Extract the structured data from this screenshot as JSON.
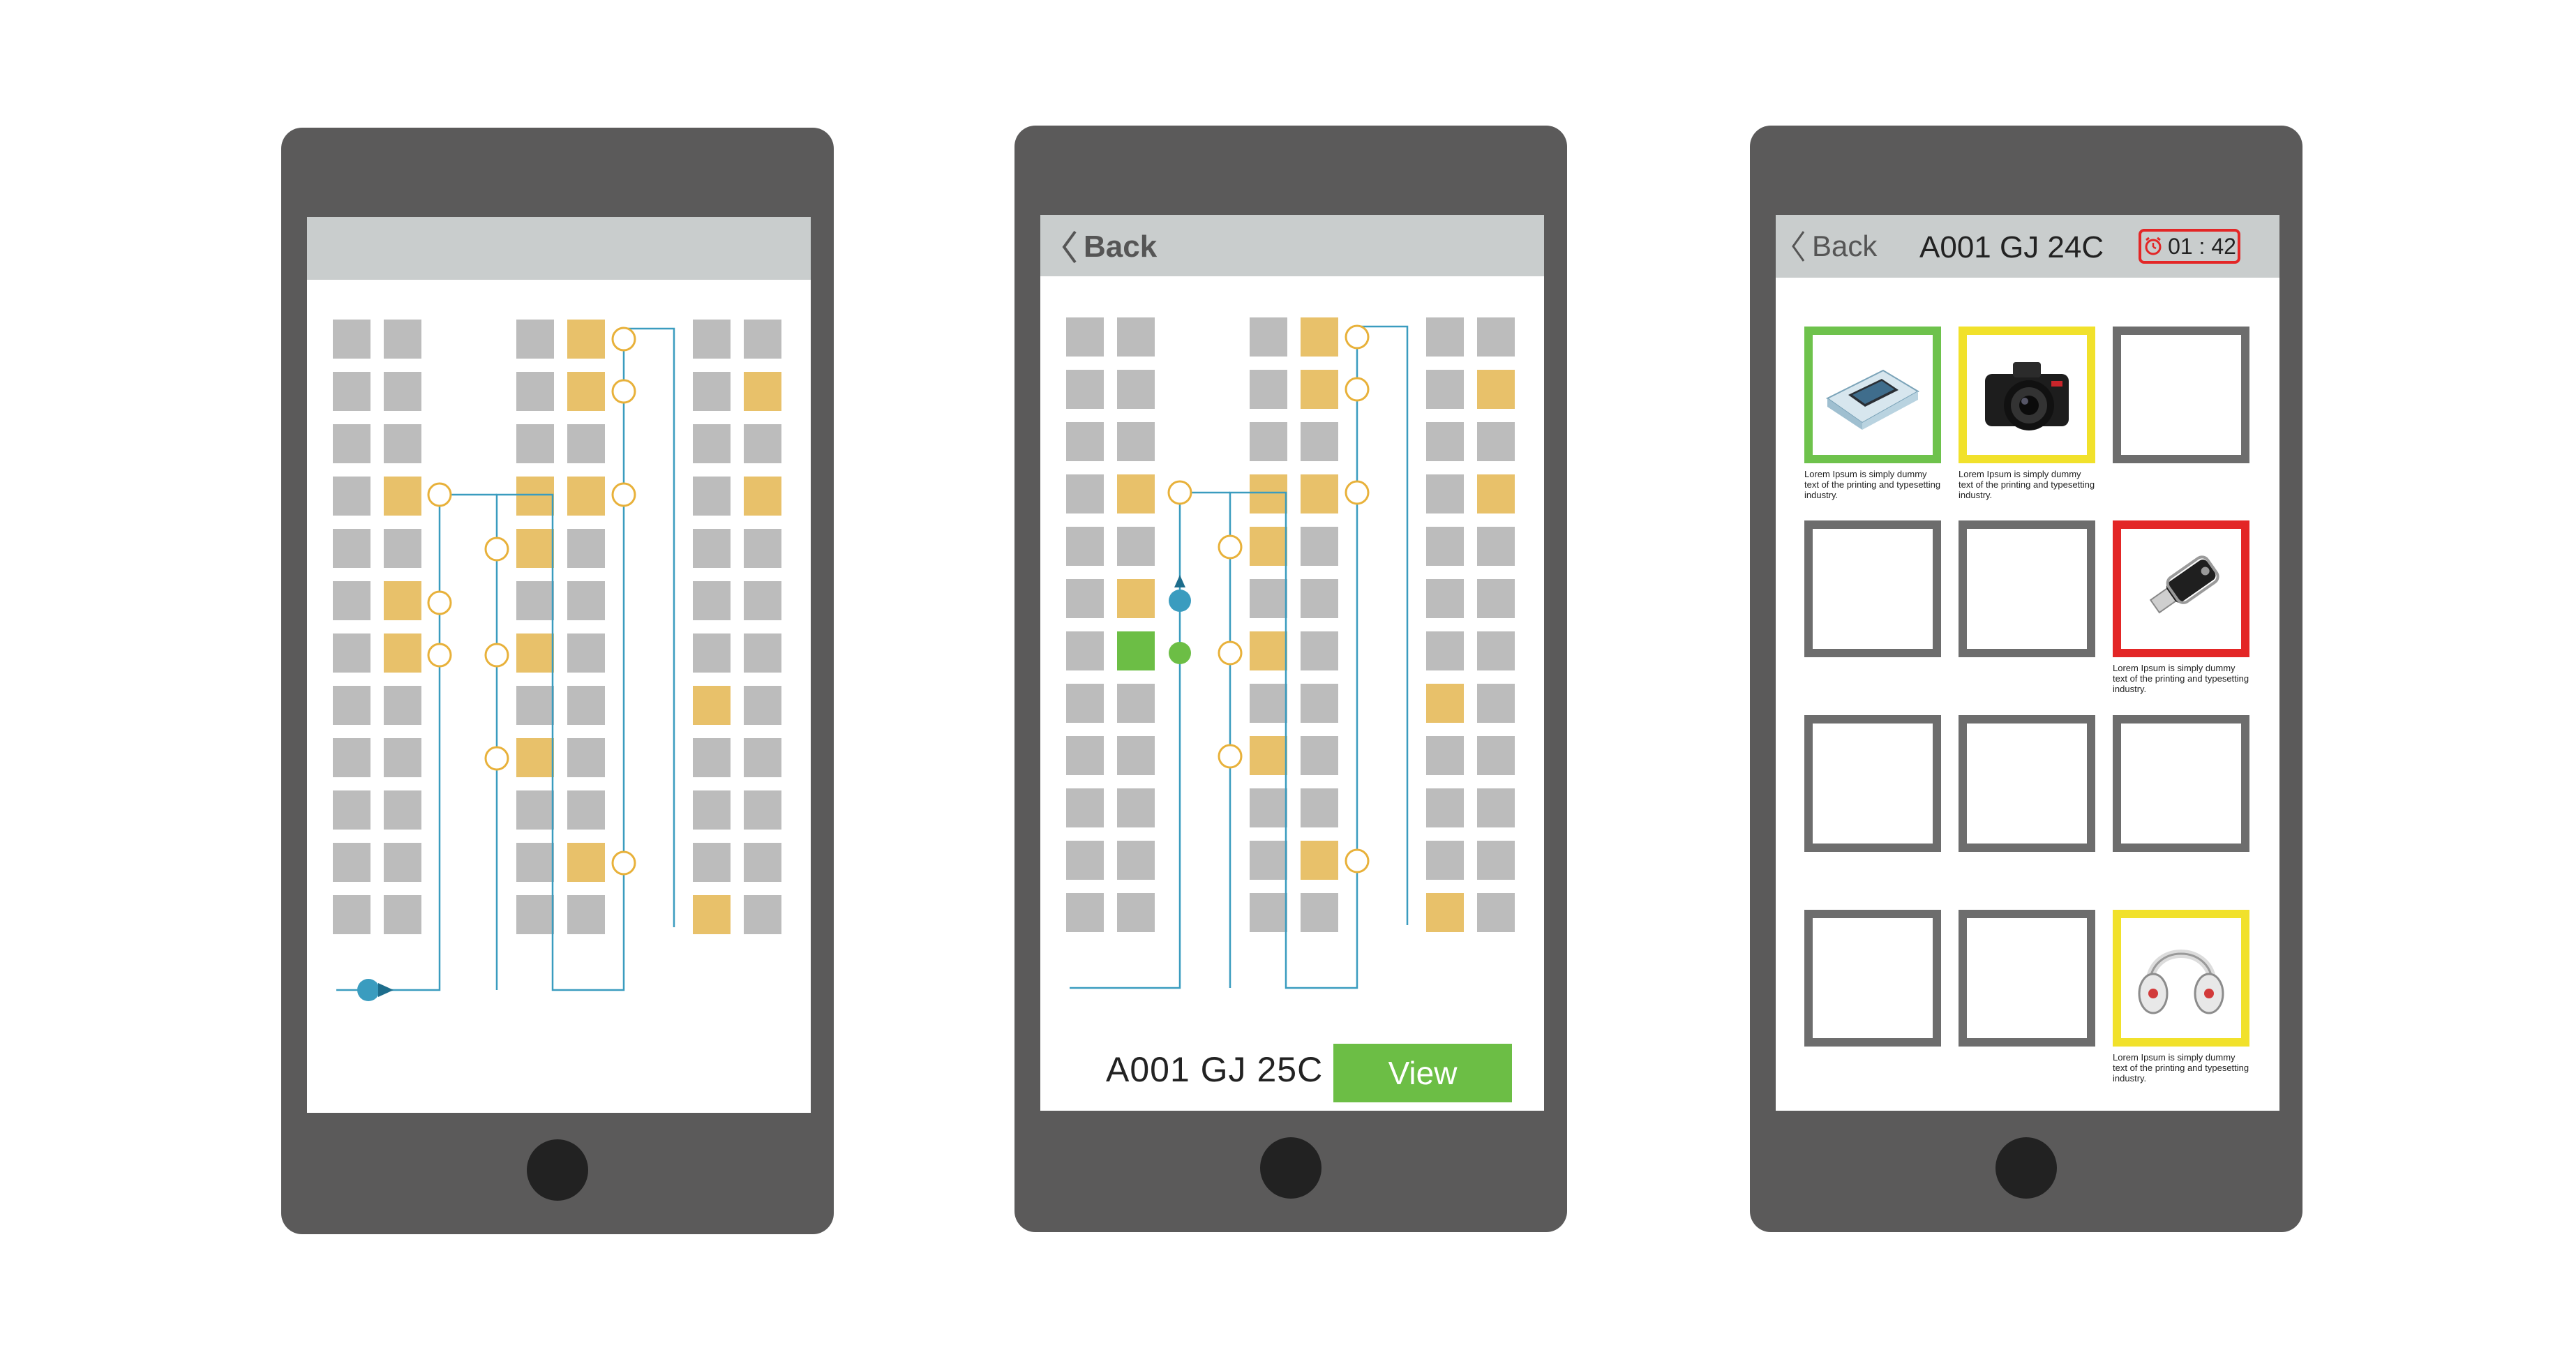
{
  "screen2": {
    "back_label": "Back",
    "seat_code": "A001 GJ 25C",
    "view_label": "View"
  },
  "screen3": {
    "back_label": "Back",
    "seat_code": "A001 GJ 24C",
    "timer": "01 : 42",
    "tiles": [
      {
        "state": "green",
        "product": "phone-box-icon",
        "caption": "Lorem Ipsum is simply dummy text of the printing and typesetting industry."
      },
      {
        "state": "yellow",
        "product": "camera-icon",
        "caption": "Lorem Ipsum is simply dummy text of the printing and typesetting industry."
      },
      {
        "state": "empty",
        "product": "",
        "caption": ""
      },
      {
        "state": "empty",
        "product": "",
        "caption": ""
      },
      {
        "state": "empty",
        "product": "",
        "caption": ""
      },
      {
        "state": "red",
        "product": "usb-drive-icon",
        "caption": "Lorem Ipsum is simply dummy text of the printing and typesetting industry."
      },
      {
        "state": "empty",
        "product": "",
        "caption": ""
      },
      {
        "state": "empty",
        "product": "",
        "caption": ""
      },
      {
        "state": "empty",
        "product": "",
        "caption": ""
      },
      {
        "state": "empty",
        "product": "",
        "caption": ""
      },
      {
        "state": "empty",
        "product": "",
        "caption": ""
      },
      {
        "state": "yellow",
        "product": "headphones-icon",
        "caption": "Lorem Ipsum is simply dummy text of the printing and typesetting industry."
      }
    ]
  },
  "colors": {
    "phone_body": "#5b5a5a",
    "topbar": "#c9cdcd",
    "seat_empty": "#bcbcbc",
    "seat_occupied": "#e8c16a",
    "seat_selected": "#6cbe45",
    "route_line": "#3a9cbf",
    "waypoint": "#e8b13a",
    "accent_green": "#6cbe45",
    "accent_yellow": "#f1e12b",
    "accent_red": "#e32626",
    "tile_border": "#6d6d6d"
  }
}
